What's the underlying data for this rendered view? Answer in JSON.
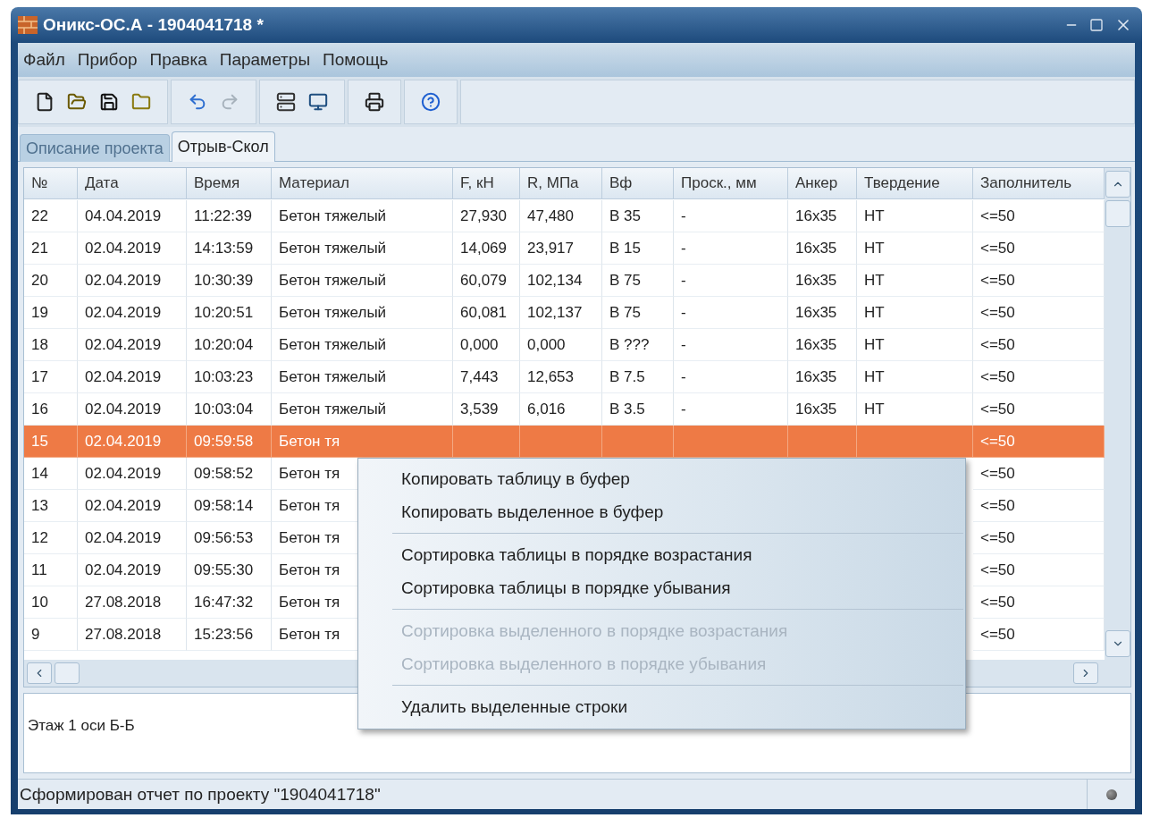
{
  "window": {
    "title": "Оникс-ОС.А - 1904041718 *"
  },
  "menu_bar": [
    "Файл",
    "Прибор",
    "Правка",
    "Параметры",
    "Помощь"
  ],
  "toolbar": [
    [
      {
        "disabled": false
      },
      {
        "disabled": false
      },
      {
        "disabled": false
      },
      {
        "disabled": false
      }
    ],
    [
      {
        "disabled": false
      },
      {
        "disabled": true
      }
    ],
    [
      {
        "disabled": false
      },
      {
        "disabled": false
      }
    ],
    [
      {
        "disabled": false
      }
    ],
    [
      {
        "disabled": false
      }
    ]
  ],
  "tabs": [
    {
      "label": "Описание проекта",
      "selected": false
    },
    {
      "label": "Отрыв-Скол",
      "selected": true
    }
  ],
  "table": {
    "columns": [
      "№",
      "Дата",
      "Время",
      "Материал",
      "F, кН",
      "R, МПа",
      "Вф",
      "Проск., мм",
      "Анкер",
      "Твердение",
      "Заполнитель"
    ],
    "rows": [
      {
        "cells": [
          "22",
          "04.04.2019",
          "11:22:39",
          "Бетон тяжелый",
          "27,930",
          "47,480",
          "В 35",
          "-",
          "16x35",
          "НТ",
          "<=50"
        ],
        "selected": false
      },
      {
        "cells": [
          "21",
          "02.04.2019",
          "14:13:59",
          "Бетон тяжелый",
          "14,069",
          "23,917",
          "В 15",
          "-",
          "16x35",
          "НТ",
          "<=50"
        ],
        "selected": false
      },
      {
        "cells": [
          "20",
          "02.04.2019",
          "10:30:39",
          "Бетон тяжелый",
          "60,079",
          "102,134",
          "В 75",
          "-",
          "16x35",
          "НТ",
          "<=50"
        ],
        "selected": false
      },
      {
        "cells": [
          "19",
          "02.04.2019",
          "10:20:51",
          "Бетон тяжелый",
          "60,081",
          "102,137",
          "В 75",
          "-",
          "16x35",
          "НТ",
          "<=50"
        ],
        "selected": false
      },
      {
        "cells": [
          "18",
          "02.04.2019",
          "10:20:04",
          "Бетон тяжелый",
          "0,000",
          "0,000",
          "В ???",
          "-",
          "16x35",
          "НТ",
          "<=50"
        ],
        "selected": false
      },
      {
        "cells": [
          "17",
          "02.04.2019",
          "10:03:23",
          "Бетон тяжелый",
          "7,443",
          "12,653",
          "В 7.5",
          "-",
          "16x35",
          "НТ",
          "<=50"
        ],
        "selected": false
      },
      {
        "cells": [
          "16",
          "02.04.2019",
          "10:03:04",
          "Бетон тяжелый",
          "3,539",
          "6,016",
          "В 3.5",
          "-",
          "16x35",
          "НТ",
          "<=50"
        ],
        "selected": false
      },
      {
        "cells": [
          "15",
          "02.04.2019",
          "09:59:58",
          "Бетон тя",
          null,
          null,
          null,
          null,
          null,
          null,
          "<=50"
        ],
        "selected": true
      },
      {
        "cells": [
          "14",
          "02.04.2019",
          "09:58:52",
          "Бетон тя",
          null,
          null,
          null,
          null,
          null,
          null,
          "<=50"
        ],
        "selected": false
      },
      {
        "cells": [
          "13",
          "02.04.2019",
          "09:58:14",
          "Бетон тя",
          null,
          null,
          null,
          null,
          null,
          null,
          "<=50"
        ],
        "selected": false
      },
      {
        "cells": [
          "12",
          "02.04.2019",
          "09:56:53",
          "Бетон тя",
          null,
          null,
          null,
          null,
          null,
          null,
          "<=50"
        ],
        "selected": false
      },
      {
        "cells": [
          "11",
          "02.04.2019",
          "09:55:30",
          "Бетон тя",
          null,
          null,
          null,
          null,
          null,
          null,
          "<=50"
        ],
        "selected": false
      },
      {
        "cells": [
          "10",
          "27.08.2018",
          "16:47:32",
          "Бетон тя",
          null,
          null,
          null,
          null,
          null,
          null,
          "<=50"
        ],
        "selected": false
      },
      {
        "cells": [
          "9",
          "27.08.2018",
          "15:23:56",
          "Бетон тя",
          null,
          null,
          null,
          null,
          null,
          null,
          "<=50"
        ],
        "selected": false
      }
    ]
  },
  "context_menu": [
    [
      {
        "label": "Копировать таблицу в буфер",
        "disabled": false
      },
      {
        "label": "Копировать выделенное в буфер",
        "disabled": false
      }
    ],
    [
      {
        "label": "Сортировка таблицы в порядке возрастания",
        "disabled": false
      },
      {
        "label": "Сортировка таблицы в порядке убывания",
        "disabled": false
      }
    ],
    [
      {
        "label": "Сортировка выделенного в порядке возрастания",
        "disabled": true
      },
      {
        "label": "Сортировка выделенного в порядке убывания",
        "disabled": true
      }
    ],
    [
      {
        "label": "Удалить выделенные строки",
        "disabled": false
      }
    ]
  ],
  "notes": {
    "value": "Этаж 1 оси Б-Б"
  },
  "status_bar": {
    "text": "Сформирован отчет по проекту \"1904041718\""
  }
}
